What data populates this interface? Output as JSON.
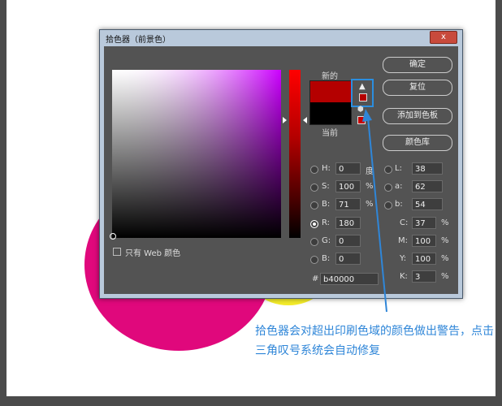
{
  "dialog": {
    "title": "拾色器（前景色）",
    "close_label": "x"
  },
  "swatches": {
    "new_label": "新的",
    "current_label": "当前",
    "new_color": "#b40000",
    "current_color": "#000000"
  },
  "buttons": {
    "ok": "确定",
    "reset": "复位",
    "add_swatch": "添加到色板",
    "libraries": "颜色库"
  },
  "hsb": {
    "h_label": "H:",
    "h_value": "0",
    "h_unit": "度",
    "s_label": "S:",
    "s_value": "100",
    "s_unit": "%",
    "b_label": "B:",
    "b_value": "71",
    "b_unit": "%"
  },
  "rgb": {
    "r_label": "R:",
    "r_value": "180",
    "g_label": "G:",
    "g_value": "0",
    "b_label": "B:",
    "b_value": "0"
  },
  "lab": {
    "l_label": "L:",
    "l_value": "38",
    "a_label": "a:",
    "a_value": "62",
    "b_label": "b:",
    "b_value": "54"
  },
  "cmyk": {
    "c_label": "C:",
    "c_value": "37",
    "m_label": "M:",
    "m_value": "100",
    "y_label": "Y:",
    "y_value": "100",
    "k_label": "K:",
    "k_value": "3",
    "unit": "%"
  },
  "hex": {
    "label": "#",
    "value": "b40000"
  },
  "web_only": {
    "label": "只有 Web 颜色"
  },
  "annotation": {
    "text": "拾色器会对超出印刷色域的颜色做出警告，点击三角叹号系统会自动修复"
  },
  "colors": {
    "accent": "#2f86d8",
    "magenta": "#e0087c",
    "yellow": "#f4ec2a"
  }
}
